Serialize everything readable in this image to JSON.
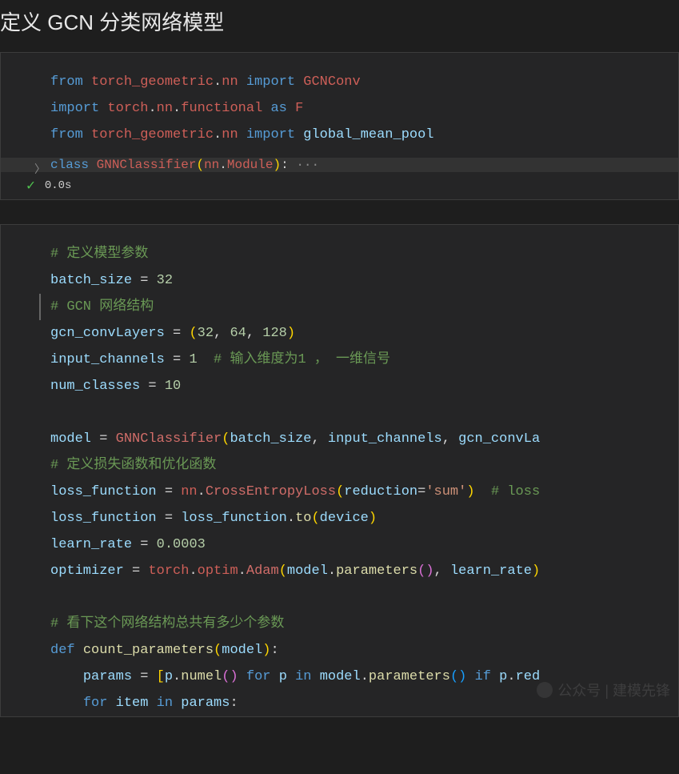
{
  "title": "定义 GCN 分类网络模型",
  "cell1": {
    "l1": {
      "from": "from",
      "mod": "torch_geometric",
      "sub": "nn",
      "imp": "import",
      "name": "GCNConv"
    },
    "l2": {
      "imp": "import",
      "mod": "torch",
      "sub1": "nn",
      "sub2": "functional",
      "as": "as",
      "alias": "F"
    },
    "l3": {
      "from": "from",
      "mod": "torch_geometric",
      "sub": "nn",
      "imp": "import",
      "name": "global_mean_pool"
    },
    "l4": {
      "cls": "class",
      "name": "GNNClassifier",
      "base1": "nn",
      "base2": "Module",
      "ell": "···"
    },
    "status": "0.0s"
  },
  "cell2": {
    "c1": "# 定义模型参数",
    "c2": "# GCN 网络结构",
    "c3": "# 输入维度为1 ， 一维信号",
    "c4": "# 定义损失函数和优化函数",
    "c5": "# loss",
    "c6": "# 看下这个网络结构总共有多少个参数",
    "v": {
      "batch_size": "batch_size",
      "gcn_convLayers": "gcn_convLayers",
      "input_channels": "input_channels",
      "num_classes": "num_classes",
      "model": "model",
      "loss_function": "loss_function",
      "learn_rate": "learn_rate",
      "optimizer": "optimizer",
      "params": "params",
      "item": "item",
      "p": "p",
      "device": "device",
      "reduction": "reduction",
      "gcn_convLa": "gcn_convLa"
    },
    "n": {
      "n32": "32",
      "n64": "64",
      "n128": "128",
      "n1": "1",
      "n10": "10",
      "n0003": "0.0003"
    },
    "s": {
      "sum": "'sum'"
    },
    "f": {
      "GNNClassifier": "GNNClassifier",
      "CrossEntropyLoss": "CrossEntropyLoss",
      "to": "to",
      "Adam": "Adam",
      "parameters": "parameters",
      "count_parameters": "count_parameters",
      "numel": "numel"
    },
    "m": {
      "nn": "nn",
      "torch": "torch",
      "optim": "optim"
    },
    "kw": {
      "def": "def",
      "for": "for",
      "in": "in",
      "if": "if"
    },
    "ext": {
      "red": "red"
    }
  },
  "watermark": "公众号 | 建模先锋"
}
